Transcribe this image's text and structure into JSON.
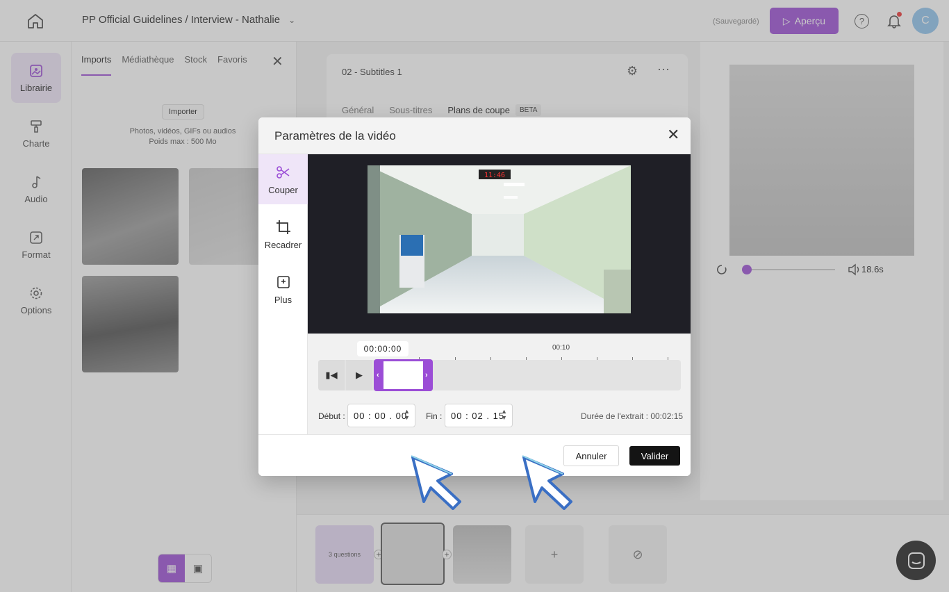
{
  "header": {
    "breadcrumb_project": "PP Official Guidelines",
    "breadcrumb_separator": "/",
    "breadcrumb_page": "Interview - Nathalie",
    "saved_status": "(Sauvegardé)",
    "preview_button": "Aperçu",
    "avatar_letter": "C"
  },
  "sidebar": {
    "items": [
      {
        "label": "Librairie",
        "icon": "library-icon"
      },
      {
        "label": "Charte",
        "icon": "paint-roller-icon"
      },
      {
        "label": "Audio",
        "icon": "music-note-icon"
      },
      {
        "label": "Format",
        "icon": "resize-icon"
      },
      {
        "label": "Options",
        "icon": "gear-icon"
      }
    ]
  },
  "library": {
    "tabs": [
      "Imports",
      "Médiathèque",
      "Stock",
      "Favoris"
    ],
    "import_button": "Importer",
    "hint_line1": "Photos, vidéos, GIFs ou audios",
    "hint_line2": "Poids max : 500 Mo"
  },
  "editor": {
    "scene_title": "02 - Subtitles 1",
    "tabs": [
      "Général",
      "Sous-titres",
      "Plans de coupe"
    ],
    "beta_badge": "BETA"
  },
  "preview": {
    "duration": "18.6s",
    "progress": 0
  },
  "timeline": {
    "question_card": "3 questions"
  },
  "modal": {
    "title": "Paramètres de la vidéo",
    "side_items": [
      {
        "label": "Couper",
        "icon": "scissors-icon"
      },
      {
        "label": "Recadrer",
        "icon": "crop-icon"
      },
      {
        "label": "Plus",
        "icon": "add-media-icon"
      }
    ],
    "frame_clock": "11:46",
    "current_time": "00:00:00",
    "tick_label": "00:10",
    "start_label": "Début :",
    "start_value": "00 : 00 . 00",
    "end_label": "Fin :",
    "end_value": "00 : 02 . 15",
    "duration_text": "Durée de l'extrait : 00:02:15",
    "cancel_button": "Annuler",
    "confirm_button": "Valider"
  },
  "colors": {
    "accent": "#9b4dd6",
    "accent_light": "#efe5f8",
    "dark_button": "#141414"
  }
}
